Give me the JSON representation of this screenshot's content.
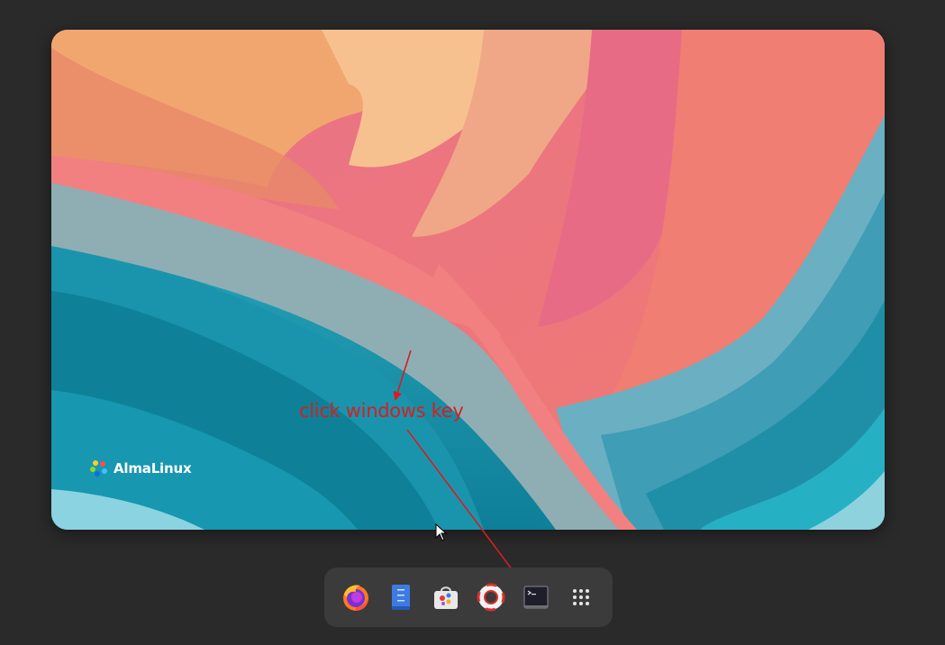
{
  "desktop": {
    "brand_name": "AlmaLinux"
  },
  "annotation": {
    "text": "click windows key",
    "color": "#d51f1f"
  },
  "dock": {
    "items": [
      {
        "name": "Firefox",
        "icon": "firefox-icon"
      },
      {
        "name": "Text Editor",
        "icon": "text-editor-icon"
      },
      {
        "name": "Software",
        "icon": "software-store-icon"
      },
      {
        "name": "Help",
        "icon": "help-lifebuoy-icon"
      },
      {
        "name": "Terminal",
        "icon": "terminal-icon"
      },
      {
        "name": "Show Applications",
        "icon": "app-grid-icon"
      }
    ]
  },
  "colors": {
    "background": "#2a2a2a",
    "dock": "#3b3b3b",
    "annotation": "#d51f1f"
  }
}
